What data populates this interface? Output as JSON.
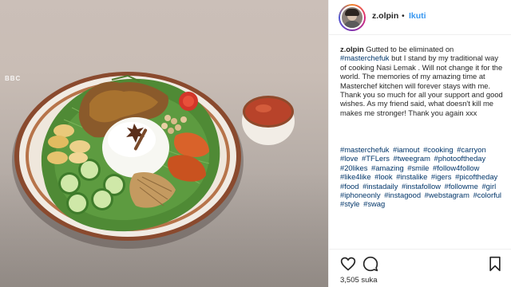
{
  "post": {
    "username": "z.olpin",
    "separator": "•",
    "follow_label": "Ikuti",
    "caption_user": "z.olpin",
    "caption_text": " Gutted to be eliminated on",
    "caption_tag1": "#masterchefuk",
    "caption_rest": " but I stand by my traditional way of cooking Nasi Lemak . Will not change it for the world. The memories of my amazing time at Masterchef kitchen will forever stays with me. Thank you so much for all your support and good wishes. As my friend said, what doesn't kill me makes me stronger! Thank you again xxx",
    "hashtags": [
      "#masterchefuk",
      "#iamout",
      "#cooking",
      "#carryon",
      "#love",
      "#TFLers",
      "#tweegram",
      "#photooftheday",
      "#20likes",
      "#amazing",
      "#smile",
      "#follow4follow",
      "#like4like",
      "#look",
      "#instalike",
      "#igers",
      "#picoftheday",
      "#food",
      "#instadaily",
      "#instafollow",
      "#followme",
      "#girl",
      "#iphoneonly",
      "#instagood",
      "#webstagram",
      "#colorful",
      "#style",
      "#swag"
    ],
    "likes": "3,505 suka",
    "watermark": "BBC"
  },
  "icons": {
    "like": "heart-icon",
    "comment": "comment-icon",
    "save": "bookmark-icon"
  },
  "colors": {
    "link": "#003569",
    "follow": "#3897f0",
    "text": "#262626"
  }
}
